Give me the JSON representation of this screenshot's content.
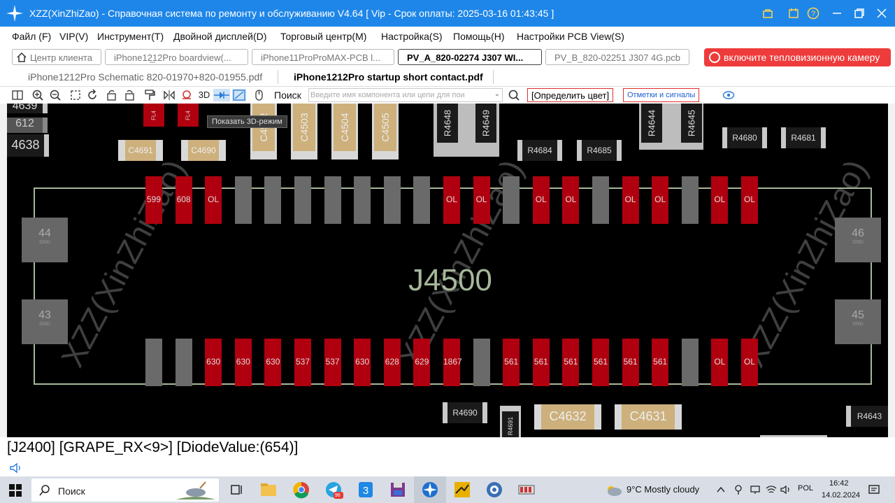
{
  "window": {
    "title": "XZZ(XinZhiZao) - Справочная система по ремонту и обслуживанию V4.64 [ Vip - Срок оплаты: 2025-03-16 01:43:45 ]"
  },
  "menu": [
    "Файл (F)",
    "VIP(V)",
    "Инструмент(T)",
    "Двойной дисплей(D)",
    "Торговый центр(M)",
    "Настройка(S)",
    "Помощь(H)",
    "Настройки PCB View(S)"
  ],
  "tabs_row1": {
    "home": "Центр клиента",
    "items": [
      "iPhone12̲12Pro boardview(...",
      "iPhone11ProProMAX-PCB l...",
      "PV_A_820-02274 J307 WI...",
      "PV_B_820-02251 J307 4G.pcb"
    ],
    "thermal_button": "включите тепловизионную камеру"
  },
  "tabs_row2": [
    "iPhone1212Pro Schematic 820-01970+820-01955.pdf",
    "iPhone1212Pro startup short contact.pdf"
  ],
  "toolbar": {
    "mode_3d": "3D",
    "search_label": "Поиск",
    "search_placeholder": "Введите имя компонента или цепи для пои",
    "define_color": "[Определить цвет]",
    "marks_signals": "Отметки и сигналы",
    "tooltip": "Показать 3D-режим"
  },
  "board": {
    "connector": "J4500",
    "watermark": "XZZ(XinZhiZao)",
    "top_pins": [
      "599",
      "608",
      "OL",
      "",
      "",
      "",
      "",
      "",
      "",
      "",
      "OL",
      "OL",
      "",
      "OL",
      "OL",
      "",
      "OL",
      "OL",
      "",
      "OL",
      "OL"
    ],
    "bottom_pins": [
      "",
      "",
      "630",
      "630",
      "630",
      "537",
      "537",
      "630",
      "628",
      "629",
      "1867",
      "",
      "561",
      "561",
      "561",
      "561",
      "561",
      "561",
      "",
      "OL",
      "OL"
    ],
    "corner_pads": [
      {
        "num": "44",
        "sub": "GND"
      },
      {
        "num": "43",
        "sub": "GND"
      },
      {
        "num": "46",
        "sub": "GND"
      },
      {
        "num": "45",
        "sub": "GND"
      }
    ],
    "components": {
      "r4684": "R4684",
      "r4685": "R4685",
      "r4680": "R4680",
      "r4681": "R4681",
      "r4690": "R4690",
      "r4643": "R4643",
      "r4691": "R4691",
      "c4691": "C4691",
      "c4690": "C4690",
      "c4632": "C4632",
      "c4631": "C4631",
      "c4502": "C4502",
      "c4503": "C4503",
      "c4504": "C4504",
      "c4505": "C4505",
      "r4648": "R4648",
      "r4649": "R4649",
      "r4644": "R4644",
      "r4645": "R4645",
      "l1": "FL4",
      "l2": "FL4",
      "side1": "4639",
      "side2": "612",
      "side3": "4638"
    }
  },
  "status": "[J2400] [GRAPE_RX<9>] [DiodeValue:(654)]",
  "taskbar": {
    "search": "Поиск",
    "weather": "9°C  Mostly cloudy",
    "lang": "POL",
    "time": "16:42",
    "date": "14.02.2024",
    "badge": "96"
  },
  "colors": {
    "titlebar": "#1e86e8",
    "pad_red": "#b0000f",
    "pad_gray": "#6a6a6a",
    "thermal": "#ee3b3b"
  }
}
